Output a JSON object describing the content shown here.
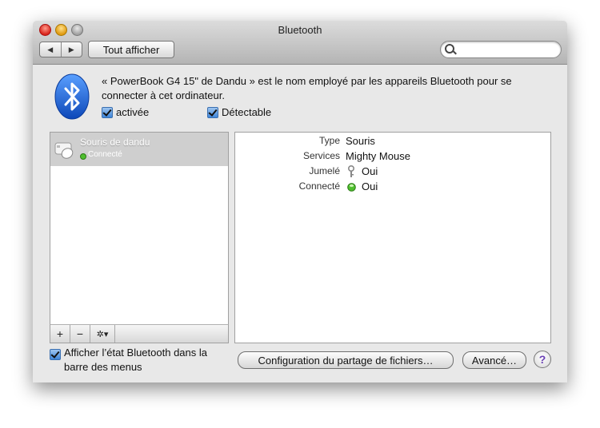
{
  "window": {
    "title": "Bluetooth"
  },
  "toolbar": {
    "show_all_label": "Tout afficher",
    "back_glyph": "◀",
    "forward_glyph": "▶",
    "search_placeholder": ""
  },
  "header": {
    "description": "« PowerBook G4 15\" de Dandu » est le nom employé par les appareils Bluetooth pour se connecter à cet ordinateur.",
    "enabled_label": "activée",
    "discoverable_label": "Détectable"
  },
  "devices": [
    {
      "name": "Souris de dandu",
      "status": "Connecté",
      "selected": true
    }
  ],
  "list_toolbar": {
    "add": "+",
    "remove": "−",
    "gear": "✲▾"
  },
  "details": [
    {
      "label": "Type",
      "value": "Souris"
    },
    {
      "label": "Services",
      "value": "Mighty Mouse"
    },
    {
      "label": "Jumelé",
      "value": "Oui",
      "icon": "key-icon"
    },
    {
      "label": "Connecté",
      "value": "Oui",
      "icon": "green-status-icon"
    }
  ],
  "footer": {
    "menu_status_label": "Afficher l’état Bluetooth dans la barre des menus",
    "file_sharing_button": "Configuration du partage de fichiers…",
    "advanced_button": "Avancé…",
    "help_glyph": "?"
  },
  "colors": {
    "status_green": "#4fbf2f",
    "bluetooth_blue": "#1e63d6",
    "selection": "#cfcfcf"
  }
}
